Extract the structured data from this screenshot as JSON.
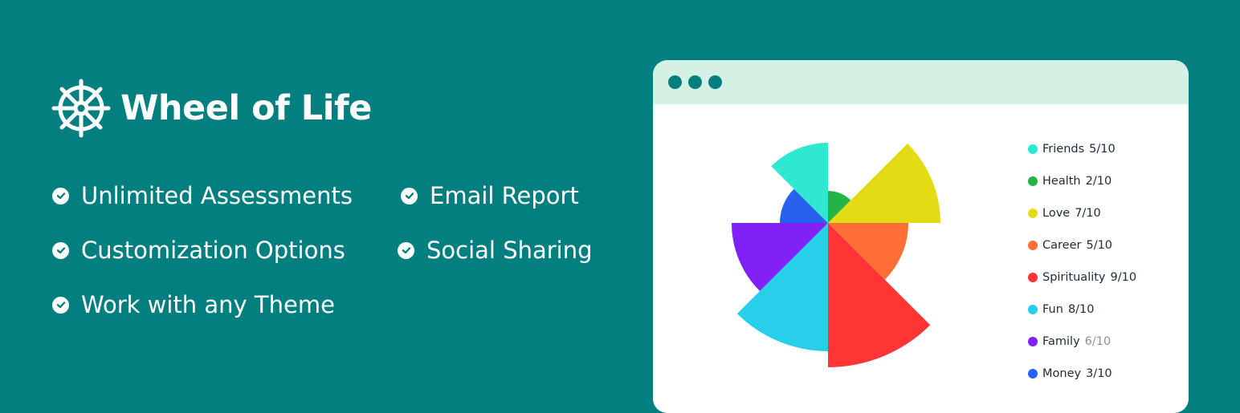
{
  "brand": {
    "name": "Wheel of Life",
    "icon": "ship-wheel-icon"
  },
  "features": [
    {
      "label": "Unlimited Assessments",
      "icon": "check-circle-icon"
    },
    {
      "label": "Email Report",
      "icon": "check-circle-icon"
    },
    {
      "label": "Customization Options",
      "icon": "check-circle-icon"
    },
    {
      "label": "Social Sharing",
      "icon": "check-circle-icon"
    },
    {
      "label": "Work with any Theme",
      "icon": "check-circle-icon"
    }
  ],
  "colors": {
    "background": "#037f7f",
    "titlebar": "#d3f2e4",
    "window": "#ffffff"
  },
  "chart_data": {
    "type": "polar-area",
    "max": 10,
    "categories": [
      {
        "name": "Friends",
        "score": "5/10",
        "value": 5,
        "color": "#2ee8d2"
      },
      {
        "name": "Health",
        "score": "2/10",
        "value": 2,
        "color": "#24b446"
      },
      {
        "name": "Love",
        "score": "7/10",
        "value": 7,
        "color": "#e3dc14"
      },
      {
        "name": "Career",
        "score": "5/10",
        "value": 5,
        "color": "#ff6e34"
      },
      {
        "name": "Spirituality",
        "score": "9/10",
        "value": 9,
        "color": "#ff3535"
      },
      {
        "name": "Fun",
        "score": "8/10",
        "value": 8,
        "color": "#28cfea"
      },
      {
        "name": "Family",
        "score": "6/10",
        "value": 6,
        "color": "#8021f6"
      },
      {
        "name": "Money",
        "score": "3/10",
        "value": 3,
        "color": "#2761f0"
      }
    ]
  }
}
